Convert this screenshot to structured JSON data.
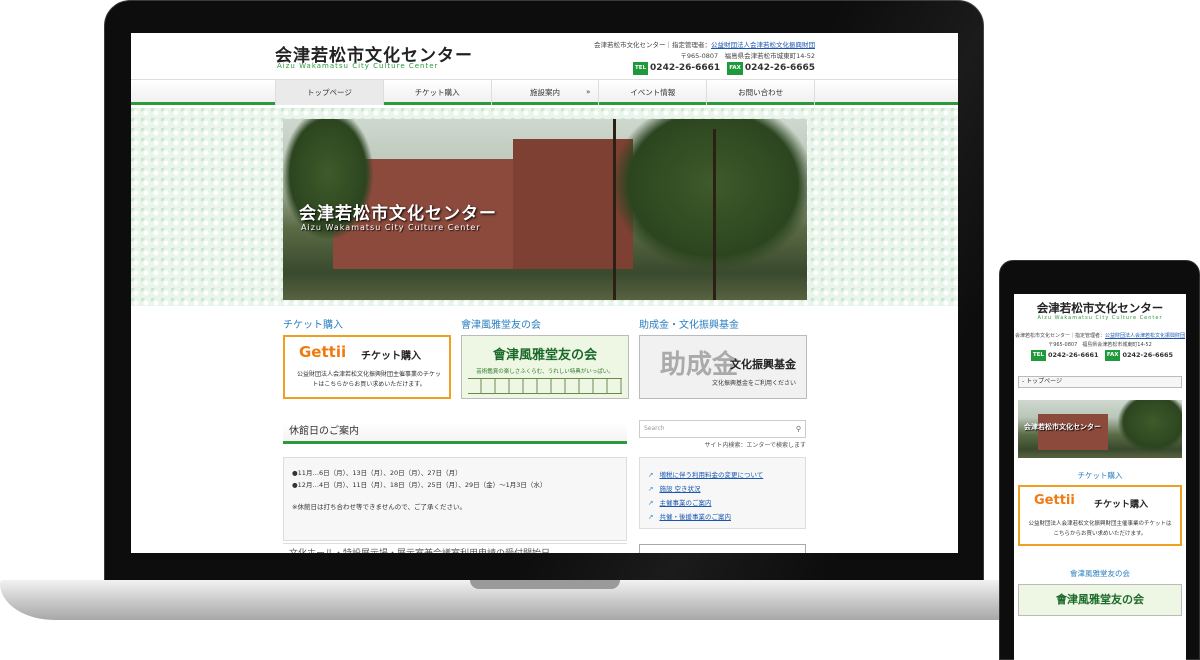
{
  "site": {
    "logo_jp": "会津若松市文化センター",
    "logo_en": "Aizu Wakamatsu City Culture Center",
    "manager_prefix": "会津若松市文化センター｜指定管理者：",
    "manager_link": "公益財団法人会津若松文化振興財団",
    "address": "〒965-0807　福島県会津若松市城東町14-52",
    "tel_tag": "TEL",
    "tel": "0242-26-6661",
    "fax_tag": "FAX",
    "fax": "0242-26-6665"
  },
  "nav": {
    "items": [
      "トップページ",
      "チケット購入",
      "施設案内",
      "イベント情報",
      "お問い合わせ"
    ],
    "submenu_arrow": "»"
  },
  "hero": {
    "title": "会津若松市文化センター",
    "subtitle": "Aizu Wakamatsu City Culture Center"
  },
  "promos": [
    {
      "heading": "チケット購入",
      "logo": "Gettii",
      "title": "チケット購入",
      "text": "公益財団法人会津若松文化振興財団主催事業のチケットはこちらからお買い求めいただけます。"
    },
    {
      "heading": "會津風雅堂友の会",
      "title": "會津風雅堂友の会",
      "text": "芸術鑑賞の楽しさふくらむ、うれしい特典がいっぱい。"
    },
    {
      "heading": "助成金・文化振興基金",
      "brush": "助成金",
      "title": "文化振興基金",
      "text": "文化振興基金をご利用ください"
    }
  ],
  "closed_days": {
    "heading": "休館日のご案内",
    "line1": "●11月…6日（月）、13日（月）、20日（月）、27日（月）",
    "line2": "●12月…4日（月）、11日（月）、18日（月）、25日（月）、29日（金）～1月3日（水）",
    "note": "※休館日は打ち合わせ等できませんので、ご了承ください。"
  },
  "next_heading": "文化ホール・特設展示場・展示室兼会議室利用申請の受付開始日",
  "search": {
    "placeholder": "Search",
    "note": "サイト内検索：エンターで検索します"
  },
  "side_links": [
    "増税に伴う利用料金の変更について",
    "施設 空き状況",
    "主催事業のご案内",
    "共催・後援事業のご案内"
  ],
  "mobile": {
    "select_value": "- トップページ",
    "hero_title": "会津若松市文化センター",
    "ticket_heading": "チケット購入",
    "fuga_heading": "會津風雅堂友の会",
    "fuga_title": "會津風雅堂友の会"
  },
  "icons": {
    "search": "search-icon",
    "external": "external-link-icon"
  },
  "colors": {
    "accent_green": "#2a9a3a",
    "link_blue": "#1a57b0",
    "heading_blue": "#2a7fc0",
    "gettii_orange": "#f07a10"
  }
}
